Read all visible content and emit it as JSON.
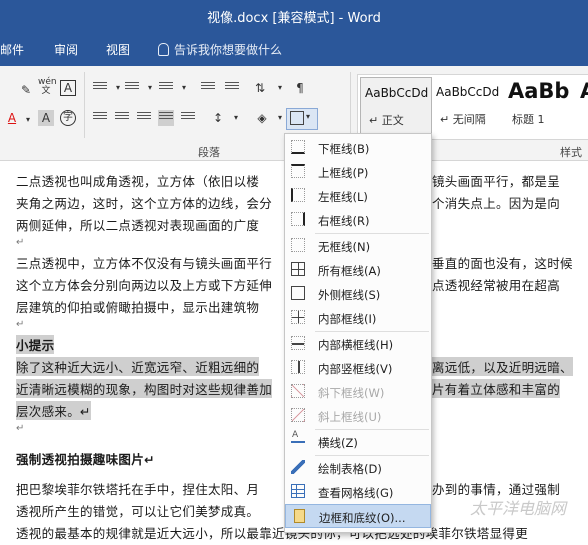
{
  "window": {
    "title": "视像.docx [兼容模式]  -  Word"
  },
  "ribbon_tabs": [
    "邮件",
    "审阅",
    "视图"
  ],
  "tell_me": {
    "placeholder": "告诉我你想要做什么"
  },
  "ribbon": {
    "paragraph_group_label": "段落",
    "styles_group_label": "样式",
    "styles": [
      {
        "sample": "AaBbCcDd",
        "name": "↵ 正文",
        "selected": true
      },
      {
        "sample": "AaBbCcDd",
        "name": "↵ 无间隔",
        "selected": false
      },
      {
        "sample": "AaBb",
        "name": "标题 1",
        "selected": false
      },
      {
        "sample": "A",
        "name": "",
        "selected": false
      }
    ],
    "pinyin_label": "wén",
    "char_border_label": "A",
    "font_color_label": "A",
    "shading_letter": "A",
    "enclose_char": "字"
  },
  "borders_menu": {
    "items": [
      {
        "label": "下框线(B)",
        "icon": "bottom-border-icon",
        "enabled": true
      },
      {
        "label": "上框线(P)",
        "icon": "top-border-icon",
        "enabled": true
      },
      {
        "label": "左框线(L)",
        "icon": "left-border-icon",
        "enabled": true
      },
      {
        "label": "右框线(R)",
        "icon": "right-border-icon",
        "enabled": true
      },
      {
        "label": "无框线(N)",
        "icon": "no-border-icon",
        "enabled": true
      },
      {
        "label": "所有框线(A)",
        "icon": "all-borders-icon",
        "enabled": true
      },
      {
        "label": "外侧框线(S)",
        "icon": "outside-borders-icon",
        "enabled": true
      },
      {
        "label": "内部框线(I)",
        "icon": "inside-borders-icon",
        "enabled": true
      },
      {
        "label": "内部横框线(H)",
        "icon": "inside-horizontal-border-icon",
        "enabled": true
      },
      {
        "label": "内部竖框线(V)",
        "icon": "inside-vertical-border-icon",
        "enabled": true
      },
      {
        "label": "斜下框线(W)",
        "icon": "diagonal-down-border-icon",
        "enabled": false
      },
      {
        "label": "斜上框线(U)",
        "icon": "diagonal-up-border-icon",
        "enabled": false
      },
      {
        "label": "横线(Z)",
        "icon": "horizontal-line-icon",
        "enabled": true
      },
      {
        "label": "绘制表格(D)",
        "icon": "draw-table-icon",
        "enabled": true
      },
      {
        "label": "查看网格线(G)",
        "icon": "view-gridlines-icon",
        "enabled": true
      },
      {
        "label": "边框和底纹(O)...",
        "icon": "borders-shading-icon",
        "enabled": true
      }
    ]
  },
  "document": {
    "lines": [
      "二点透视也叫成角透视，立方体（依旧以楼",
      "夹角之两边，这时，这个立方体的边线，会分",
      "两侧延伸，所以二点透视对表现画面的广度",
      "↵",
      "三点透视中，立方体不仅没有与镜头画面平行",
      "这个立方体会分别向两边以及上方或下方延伸",
      "层建筑的仰拍或俯瞰拍摄中，显示出建筑物",
      "↵",
      "小提示",
      "除了这种近大远小、近宽远窄、近粗远细的",
      "近清晰远模糊的现象，构图时对这些规律善加",
      "层次感来。↵",
      "↵",
      "强制透视拍摄趣味图片↵",
      "把巴黎埃菲尔铁塔托在手中，捏住太阳、月",
      "透视所产生的错觉，可以让它们美梦成真。",
      "透视的最基本的规律就是近大远小，所以最靠近镜头的你，可以把远处的埃菲尔铁塔显得更"
    ],
    "right_fragments": [
      "镜头画面平行，都是呈",
      "个消失点上。因为是向",
      "垂直的面也没有，这时候",
      "点透视经常被用在超高",
      "离远低，以及近明远暗、",
      "片有着立体感和丰富的",
      "办到的事情，通过强制"
    ]
  },
  "watermark": "太平洋电脑网"
}
